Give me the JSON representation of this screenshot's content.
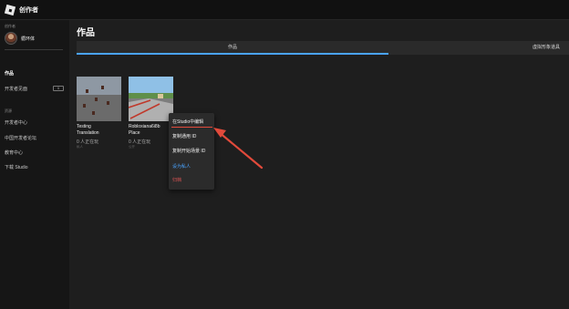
{
  "app": {
    "title": "创作者"
  },
  "sidebar": {
    "creator_label": "创作者",
    "username": "循环体",
    "items": [
      {
        "label": "作品"
      },
      {
        "label": "开发者见面"
      }
    ],
    "beta_badge": "ß",
    "resources_label": "资源",
    "links": [
      {
        "label": "开发者中心"
      },
      {
        "label": "中国开发者论坛"
      },
      {
        "label": "教育中心"
      },
      {
        "label": "下载 Studio"
      }
    ]
  },
  "main": {
    "title": "作品",
    "tabs": [
      {
        "label": "作品"
      },
      {
        "label": "虚拟形象道具"
      }
    ]
  },
  "experiences": [
    {
      "title_line1": "Testing",
      "title_line2": "Translation",
      "playing": "0 人正在玩",
      "status": "私人"
    },
    {
      "title_line1": "Robloxiana6i8b",
      "title_line2": "Place",
      "playing": "0 人正在玩",
      "status": "公开"
    }
  ],
  "context_menu": {
    "items": [
      {
        "label": "在Studio中编辑"
      },
      {
        "label": "复制通用 ID"
      },
      {
        "label": "复制开始场景 ID"
      },
      {
        "label": "设为私人"
      },
      {
        "label": "归档"
      }
    ]
  },
  "colors": {
    "accent": "#4aa3ff",
    "annotation": "#e24a3b",
    "danger": "#e05555"
  }
}
